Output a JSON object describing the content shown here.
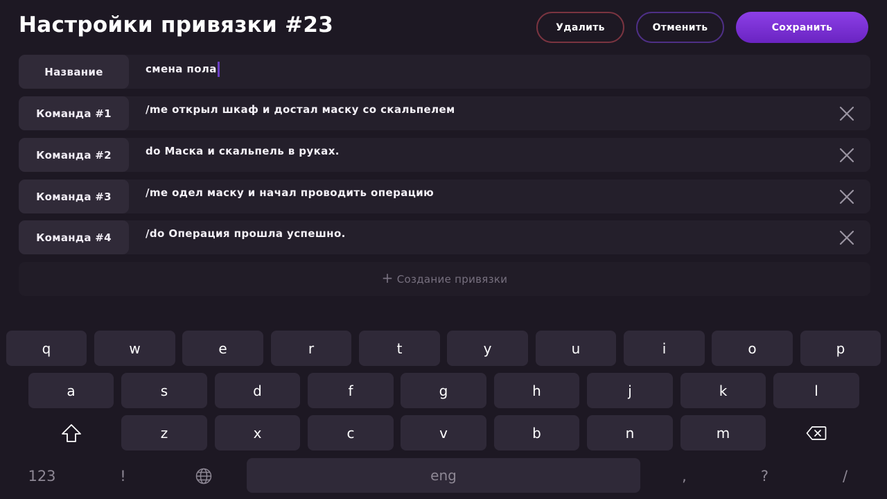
{
  "header": {
    "title": "Настройки привязки #23",
    "delete_label": "Удалить",
    "cancel_label": "Отменить",
    "save_label": "Сохранить"
  },
  "form": {
    "name_label": "Название",
    "name_value": "смена пола",
    "commands": [
      {
        "label": "Команда #1",
        "value": "/me открыл шкаф и достал маску со скальпелем"
      },
      {
        "label": "Команда #2",
        "value": "do Маска и скальпель в руках."
      },
      {
        "label": "Команда #3",
        "value": "/me одел маску и начал проводить операцию"
      },
      {
        "label": "Команда #4",
        "value": "/do Операция прошла успешно."
      }
    ],
    "create_label": "Создание привязки",
    "create_icon": "plus-icon",
    "remove_icon": "close-icon"
  },
  "keyboard": {
    "row1": [
      "q",
      "w",
      "e",
      "r",
      "t",
      "y",
      "u",
      "i",
      "o",
      "p"
    ],
    "row2": [
      "a",
      "s",
      "d",
      "f",
      "g",
      "h",
      "j",
      "k",
      "l"
    ],
    "row3": [
      "z",
      "x",
      "c",
      "v",
      "b",
      "n",
      "m"
    ],
    "shift_icon": "shift-icon",
    "backspace_icon": "backspace-icon",
    "globe_icon": "globe-icon",
    "numbers_label": "123",
    "exclamation_label": "!",
    "space_label": "eng",
    "comma_label": ",",
    "question_label": "?",
    "slash_label": "/"
  },
  "colors": {
    "background": "#1d1823",
    "accent": "#7b33d8",
    "delete_border": "#7a3440",
    "cancel_border": "#4e2f86"
  }
}
